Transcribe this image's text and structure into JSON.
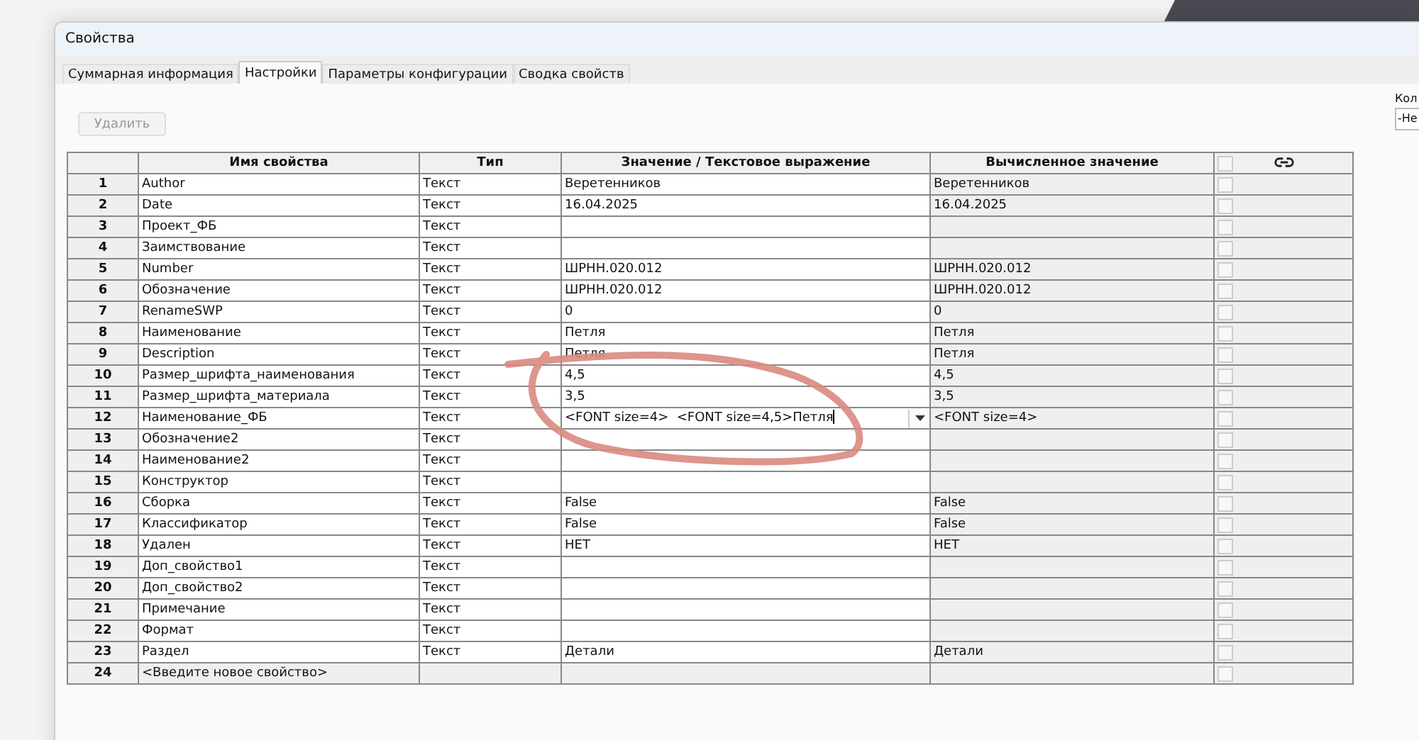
{
  "window": {
    "title": "Свойства"
  },
  "tabs": [
    {
      "label": "Суммарная информация",
      "selected": false
    },
    {
      "label": "Настройки",
      "selected": true
    },
    {
      "label": "Параметры конфигурации",
      "selected": false
    },
    {
      "label": "Сводка свойств",
      "selected": false
    }
  ],
  "toolbar": {
    "delete_button": {
      "label": "Удалить",
      "disabled": true
    },
    "config_label": "Кол",
    "config_select": "-Не"
  },
  "table": {
    "columns": [
      "Имя свойства",
      "Тип",
      "Значение / Текстовое выражение",
      "Вычисленное значение"
    ],
    "header_checked": false,
    "rows": [
      {
        "number": "1",
        "name": "Author",
        "type": "Текст",
        "value": "Веретенников",
        "computed": "Веретенников",
        "checked": false
      },
      {
        "number": "2",
        "name": "Date",
        "type": "Текст",
        "value": "16.04.2025",
        "computed": "16.04.2025",
        "checked": false
      },
      {
        "number": "3",
        "name": "Проект_ФБ",
        "type": "Текст",
        "checked": false
      },
      {
        "number": "4",
        "name": "Заимствование",
        "type": "Текст",
        "checked": false
      },
      {
        "number": "5",
        "name": "Number",
        "type": "Текст",
        "value": "ШРНН.020.012",
        "computed": "ШРНН.020.012",
        "checked": false
      },
      {
        "number": "6",
        "name": "Обозначение",
        "type": "Текст",
        "value": "ШРНН.020.012",
        "computed": "ШРНН.020.012",
        "checked": false
      },
      {
        "number": "7",
        "name": "RenameSWP",
        "type": "Текст",
        "value": "0",
        "computed": "0",
        "checked": false
      },
      {
        "number": "8",
        "name": "Наименование",
        "type": "Текст",
        "value": "Петля",
        "computed": "Петля",
        "checked": false
      },
      {
        "number": "9",
        "name": "Description",
        "type": "Текст",
        "value": "Петля",
        "computed": "Петля",
        "checked": false
      },
      {
        "number": "10",
        "name": "Размер_шрифта_наименования",
        "type": "Текст",
        "value": "4,5",
        "computed": "4,5",
        "checked": false
      },
      {
        "number": "11",
        "name": "Размер_шрифта_материала",
        "type": "Текст",
        "value": "3,5",
        "computed": "3,5",
        "checked": false
      },
      {
        "number": "12",
        "name": "Наименование_ФБ",
        "type": "Текст",
        "value": "<FONT size=4>  <FONT size=4,5>Петля",
        "computed": "<FONT size=4>",
        "checked": false,
        "editing": true
      },
      {
        "number": "13",
        "name": "Обозначение2",
        "type": "Текст",
        "checked": false
      },
      {
        "number": "14",
        "name": "Наименование2",
        "type": "Текст",
        "checked": false
      },
      {
        "number": "15",
        "name": "Конструктор",
        "type": "Текст",
        "checked": false
      },
      {
        "number": "16",
        "name": "Сборка",
        "type": "Текст",
        "value": "False",
        "computed": "False",
        "checked": false
      },
      {
        "number": "17",
        "name": "Классификатор",
        "type": "Текст",
        "value": "False",
        "computed": "False",
        "checked": false
      },
      {
        "number": "18",
        "name": "Удален",
        "type": "Текст",
        "value": "НЕТ",
        "computed": "НЕТ",
        "checked": false
      },
      {
        "number": "19",
        "name": "Доп_свойство1",
        "type": "Текст",
        "checked": false
      },
      {
        "number": "20",
        "name": "Доп_свойство2",
        "type": "Текст",
        "checked": false
      },
      {
        "number": "21",
        "name": "Примечание",
        "type": "Текст",
        "checked": false
      },
      {
        "number": "22",
        "name": "Формат",
        "type": "Текст",
        "checked": false
      },
      {
        "number": "23",
        "name": "Раздел",
        "type": "Текст",
        "value": "Детали",
        "computed": "Детали",
        "checked": false
      },
      {
        "number": "24",
        "name": "<Введите новое свойство>",
        "checked": false,
        "kind": "new"
      }
    ]
  }
}
